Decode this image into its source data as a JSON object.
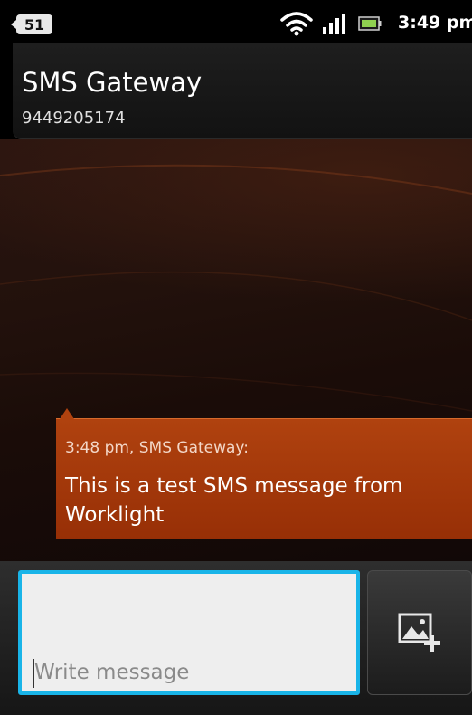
{
  "status_bar": {
    "notification_count": "51",
    "time": "3:49 pm",
    "icons": [
      "notification-badge",
      "wifi-icon",
      "signal-icon",
      "battery-icon"
    ]
  },
  "header": {
    "title": "SMS Gateway",
    "subtitle": "9449205174"
  },
  "conversation": {
    "messages": [
      {
        "meta": "3:48 pm, SMS Gateway:",
        "body": "This is a test SMS message from Worklight"
      }
    ]
  },
  "compose": {
    "placeholder": "Write message",
    "attach_icon": "attach-image-icon"
  },
  "colors": {
    "accent": "#19b4e8",
    "bubble": "#a43a0b",
    "background": "#1a0c08"
  }
}
